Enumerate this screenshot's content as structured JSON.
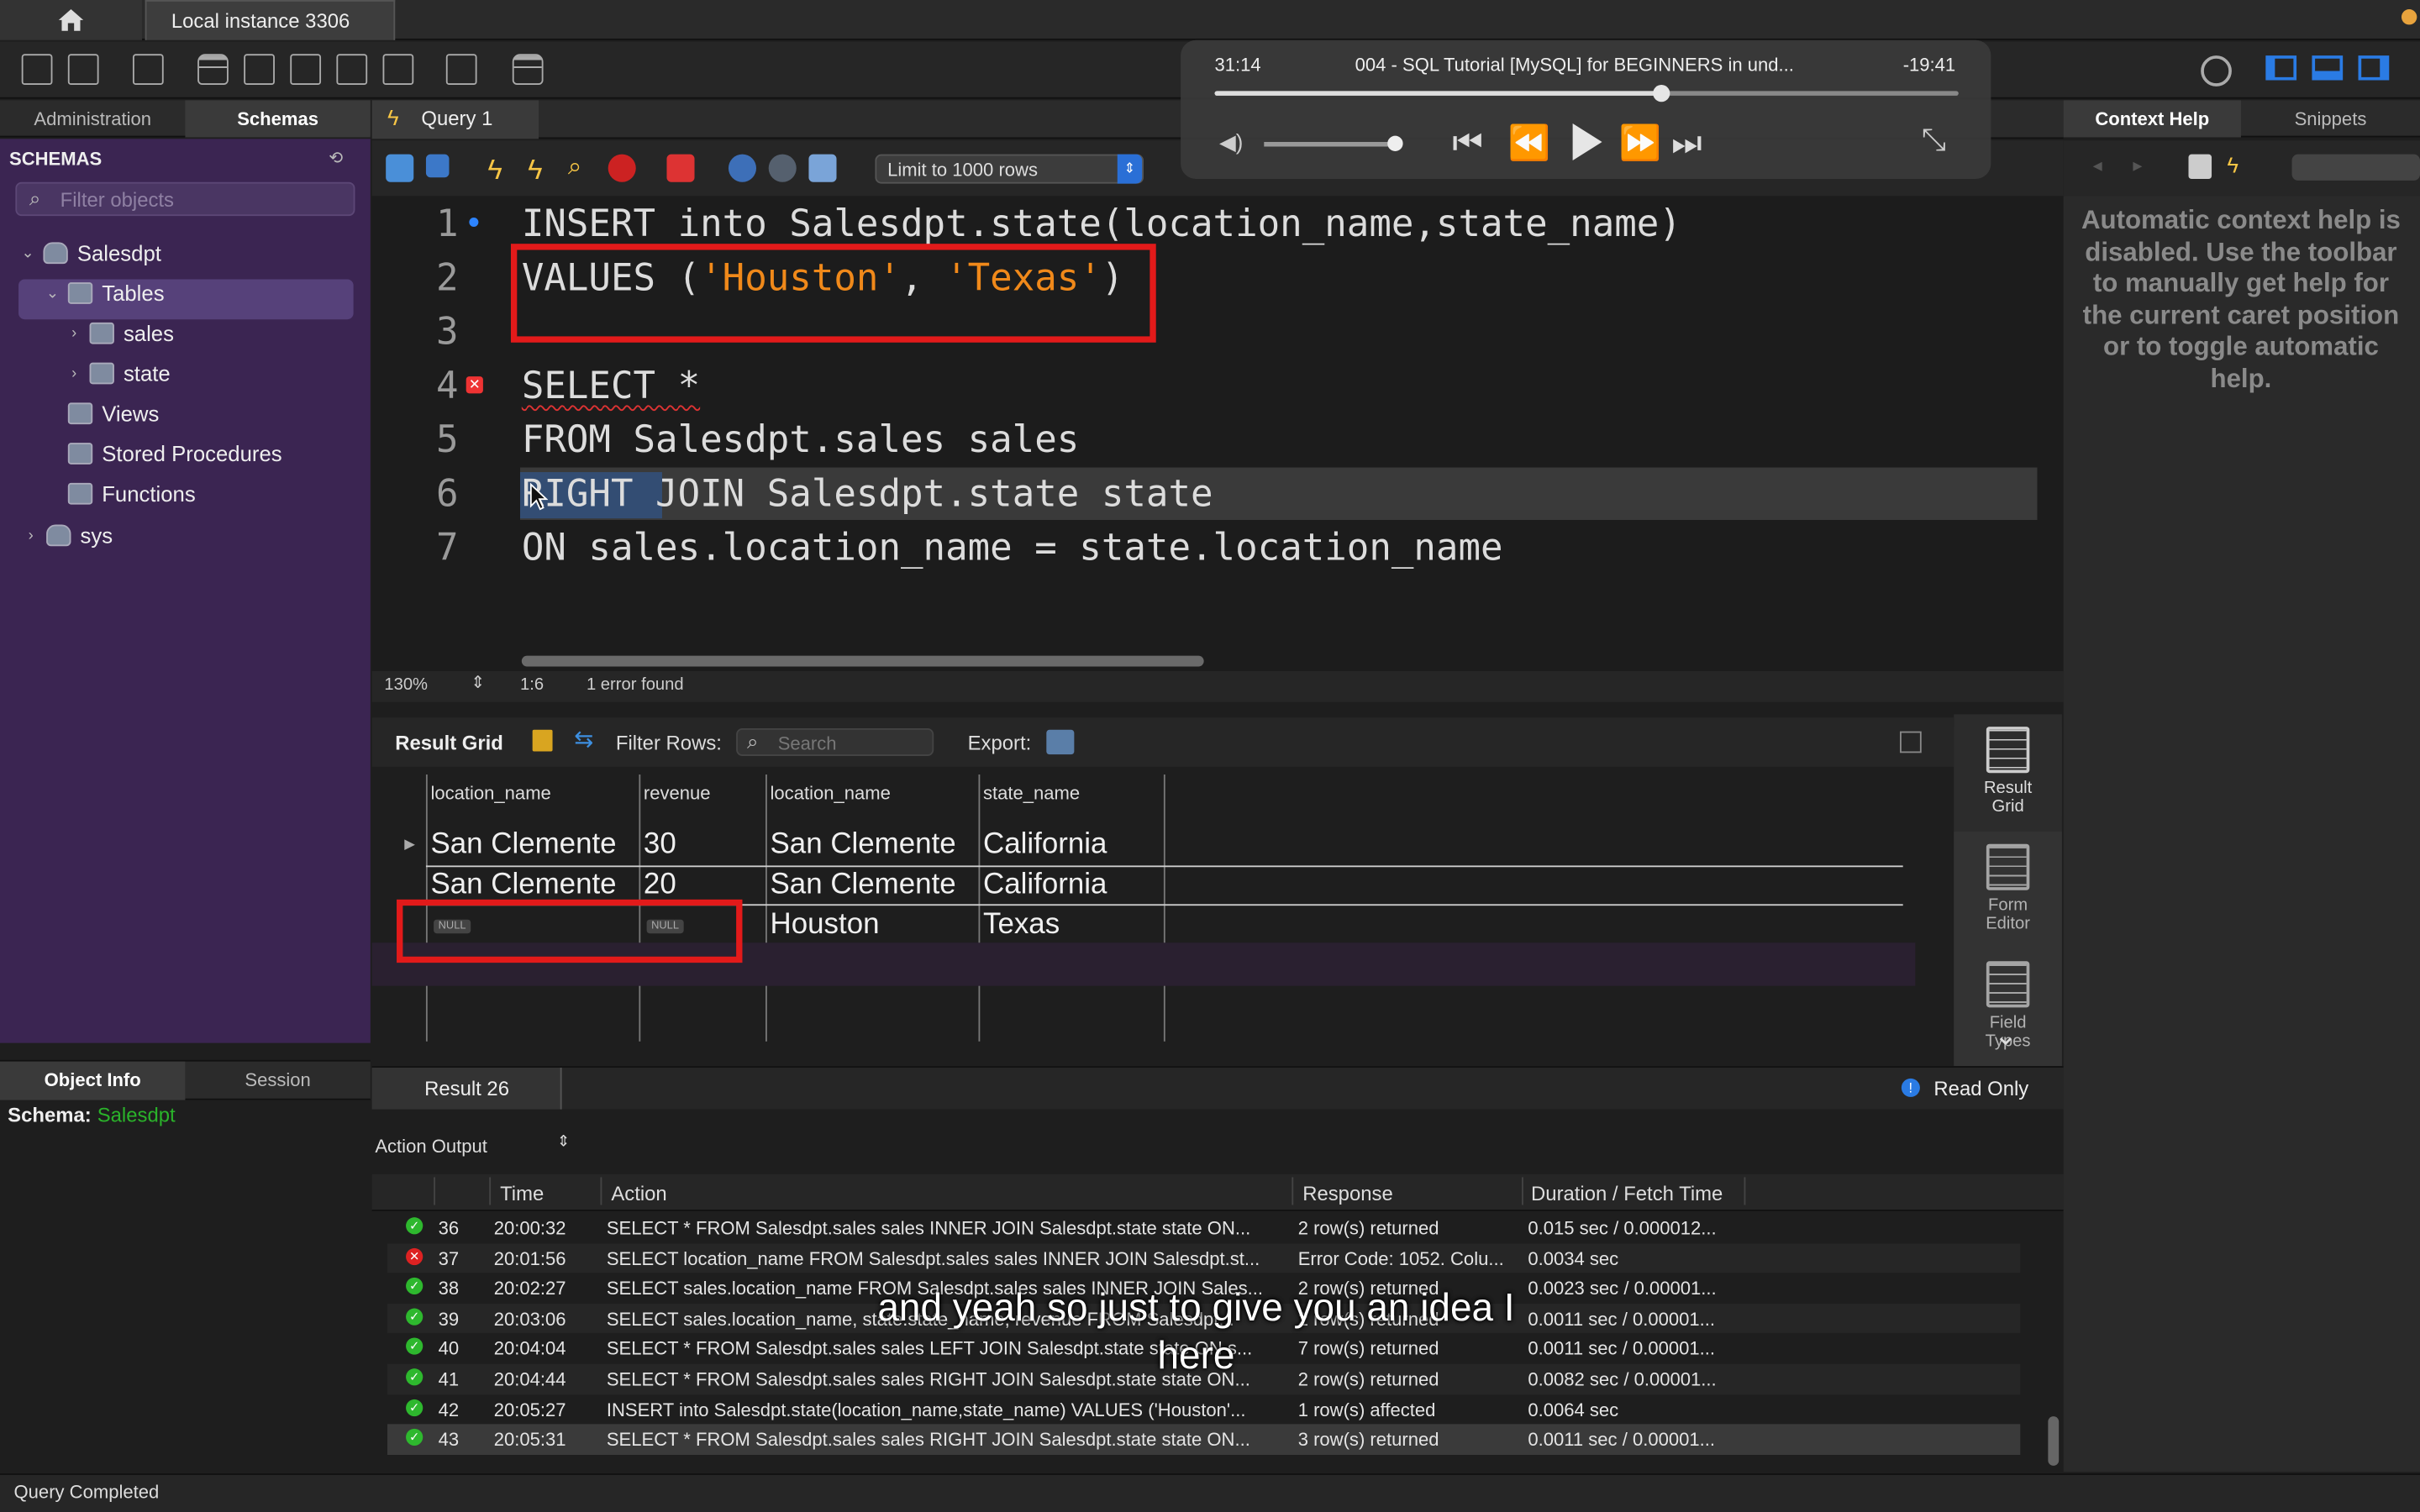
{
  "window": {
    "connection_tab": "Local instance 3306"
  },
  "left_panel": {
    "tabs": [
      "Administration",
      "Schemas"
    ],
    "schemas_heading": "SCHEMAS",
    "filter_placeholder": "Filter objects",
    "tree": {
      "salesdpt": "Salesdpt",
      "tables": "Tables",
      "sales": "sales",
      "state": "state",
      "views": "Views",
      "stored_procedures": "Stored Procedures",
      "functions": "Functions",
      "sys": "sys"
    },
    "bottom_tabs": [
      "Object Info",
      "Session"
    ],
    "schema_label": "Schema:",
    "schema_value": "Salesdpt"
  },
  "query_tab": {
    "label": "Query 1"
  },
  "editor_toolbar": {
    "limit": "Limit to 1000 rows"
  },
  "editor": {
    "line_numbers": [
      "1",
      "2",
      "3",
      "4",
      "5",
      "6",
      "7"
    ],
    "lines": {
      "l1": "INSERT into Salesdpt.state(location_name,state_name)",
      "l2a": "VALUES (",
      "l2b": "'Houston'",
      "l2c": ", ",
      "l2d": "'Texas'",
      "l2e": ")",
      "l4": "SELECT *",
      "l5": "FROM Salesdpt.sales sales",
      "l6a": "RIGHT",
      "l6b": " JOIN Salesdpt.state state",
      "l7": "ON sales.location_name = state.location_name"
    },
    "status": {
      "zoom": "130%",
      "position": "1:6",
      "errors": "1 error found"
    }
  },
  "result": {
    "title": "Result Grid",
    "filter_label": "Filter Rows:",
    "search_placeholder": "Search",
    "export_label": "Export:",
    "columns": [
      "location_name",
      "revenue",
      "location_name",
      "state_name"
    ],
    "rows": [
      [
        "San Clemente",
        "30",
        "San Clemente",
        "California"
      ],
      [
        "San Clemente",
        "20",
        "San Clemente",
        "California"
      ],
      [
        "NULL",
        "NULL",
        "Houston",
        "Texas"
      ]
    ],
    "side_tools": {
      "grid_line1": "Result",
      "grid_line2": "Grid",
      "form_line1": "Form",
      "form_line2": "Editor",
      "field_line1": "Field",
      "field_line2": "Types"
    },
    "tab_label": "Result 26",
    "read_only": "Read Only"
  },
  "action_output": {
    "selector": "Action Output",
    "columns": [
      "Time",
      "Action",
      "Response",
      "Duration / Fetch Time"
    ],
    "rows": [
      {
        "status": "ok",
        "id": "36",
        "time": "20:00:32",
        "action": "SELECT * FROM Salesdpt.sales sales INNER JOIN Salesdpt.state state ON...",
        "response": "2 row(s) returned",
        "duration": "0.015 sec / 0.000012..."
      },
      {
        "status": "error",
        "id": "37",
        "time": "20:01:56",
        "action": "SELECT location_name FROM Salesdpt.sales sales INNER JOIN Salesdpt.st...",
        "response": "Error Code: 1052. Colu...",
        "duration": "0.0034 sec"
      },
      {
        "status": "ok",
        "id": "38",
        "time": "20:02:27",
        "action": "SELECT sales.location_name FROM Salesdpt.sales sales INNER JOIN Sales...",
        "response": "2 row(s) returned",
        "duration": "0.0023 sec / 0.00001..."
      },
      {
        "status": "ok",
        "id": "39",
        "time": "20:03:06",
        "action": "SELECT sales.location_name, state.state_name, revenue FROM Salesdpt...",
        "response": "2 row(s) returned",
        "duration": "0.0011 sec / 0.00001..."
      },
      {
        "status": "ok",
        "id": "40",
        "time": "20:04:04",
        "action": "SELECT * FROM Salesdpt.sales sales LEFT JOIN Salesdpt.state state ON s...",
        "response": "7 row(s) returned",
        "duration": "0.0011 sec / 0.00001..."
      },
      {
        "status": "ok",
        "id": "41",
        "time": "20:04:44",
        "action": "SELECT * FROM Salesdpt.sales sales RIGHT JOIN Salesdpt.state state ON...",
        "response": "2 row(s) returned",
        "duration": "0.0082 sec / 0.00001..."
      },
      {
        "status": "ok",
        "id": "42",
        "time": "20:05:27",
        "action": "INSERT into Salesdpt.state(location_name,state_name) VALUES ('Houston'...",
        "response": "1 row(s) affected",
        "duration": "0.0064 sec"
      },
      {
        "status": "ok",
        "id": "43",
        "time": "20:05:31",
        "action": "SELECT * FROM Salesdpt.sales sales RIGHT JOIN Salesdpt.state state ON...",
        "response": "3 row(s) returned",
        "duration": "0.0011 sec / 0.00001..."
      }
    ]
  },
  "right_panel": {
    "tabs": [
      "Context Help",
      "Snippets"
    ],
    "help_text": "Automatic context help is disabled. Use the toolbar to manually get help for the current caret position or to toggle automatic help."
  },
  "media": {
    "elapsed": "31:14",
    "title": "004 - SQL Tutorial [MySQL] for BEGINNERS in und...",
    "remaining": "-19:41",
    "progress": 0.6
  },
  "subtitle": {
    "line1": "and yeah so just to give you an idea I",
    "line2": "here"
  },
  "status_bar": {
    "text": "Query Completed"
  }
}
